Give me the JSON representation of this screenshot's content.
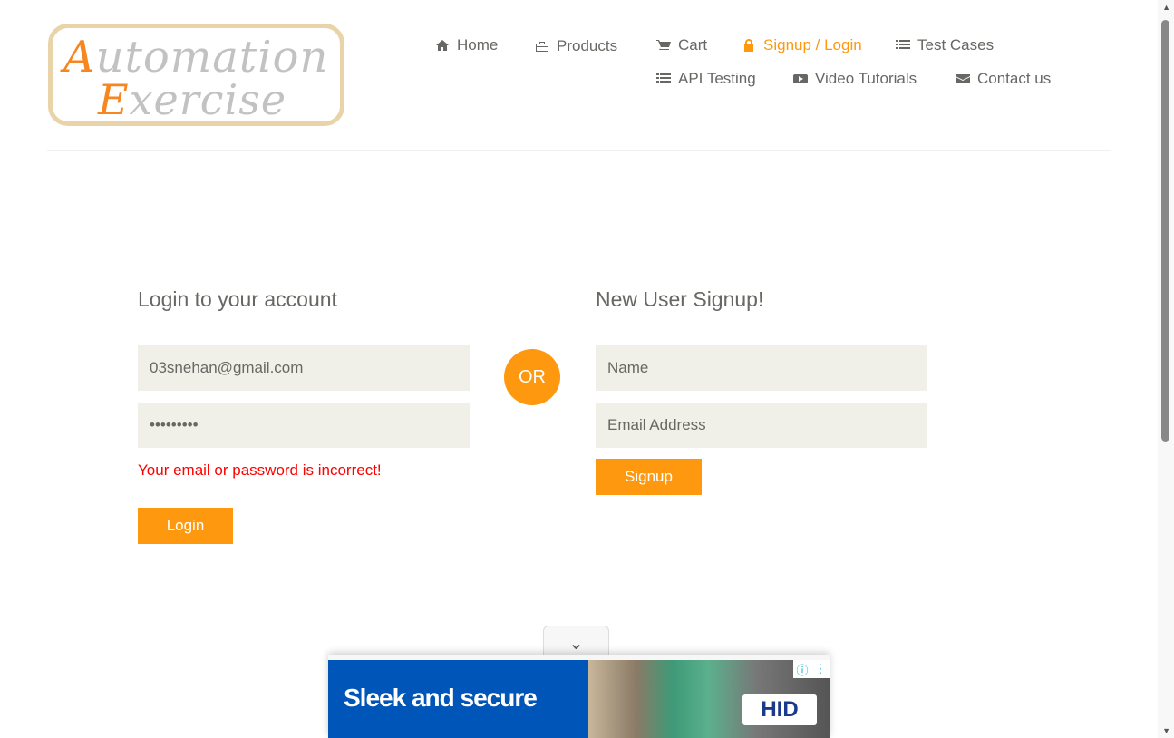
{
  "logo": {
    "line1_first": "A",
    "line1_rest": "utomation",
    "line2_first": "E",
    "line2_rest": "xercise"
  },
  "nav": [
    {
      "label": "Home",
      "icon": "home-icon"
    },
    {
      "label": "Products",
      "icon": "briefcase-icon"
    },
    {
      "label": "Cart",
      "icon": "cart-icon"
    },
    {
      "label": "Signup / Login",
      "icon": "lock-icon",
      "active": true
    },
    {
      "label": "Test Cases",
      "icon": "list-icon"
    },
    {
      "label": "API Testing",
      "icon": "list-icon"
    },
    {
      "label": "Video Tutorials",
      "icon": "youtube-play-icon"
    },
    {
      "label": "Contact us",
      "icon": "envelope-icon"
    }
  ],
  "login": {
    "title": "Login to your account",
    "email": "03snehan@gmail.com",
    "password": "•••••••••",
    "error": "Your email or password is incorrect!",
    "button": "Login"
  },
  "or": "OR",
  "signup": {
    "title": "New User Signup!",
    "name_placeholder": "Name",
    "email_placeholder": "Email Address",
    "button": "Signup"
  },
  "ad": {
    "headline": "Sleek and secure",
    "brand": "HID",
    "info": "ⓘ",
    "menu": "⋮"
  },
  "colors": {
    "accent": "#fe980f",
    "error": "#ff0000",
    "input_bg": "#f0f0e9"
  }
}
